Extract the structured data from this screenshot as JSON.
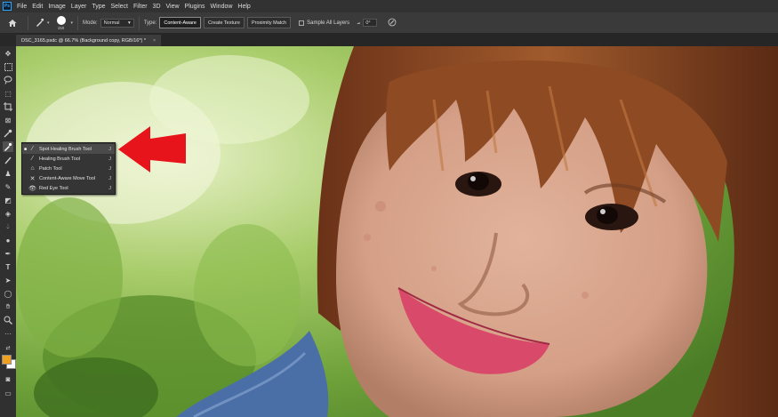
{
  "app": {
    "logo": "Ps"
  },
  "menu": [
    "File",
    "Edit",
    "Image",
    "Layer",
    "Type",
    "Select",
    "Filter",
    "3D",
    "View",
    "Plugins",
    "Window",
    "Help"
  ],
  "options": {
    "brush_size": "150",
    "mode_label": "Mode:",
    "mode_value": "Normal",
    "type_label": "Type:",
    "type_buttons": [
      "Content-Aware",
      "Create Texture",
      "Proximity Match"
    ],
    "sample_all_layers": "Sample All Layers",
    "angle_value": "0°"
  },
  "document_tab": {
    "title": "DSC_3165.psdc @ 66.7% (Background copy, RGB/16*) *",
    "close": "×"
  },
  "flyout": [
    {
      "label": "Spot Healing Brush Tool",
      "shortcut": "J",
      "icon": "spot-healing-brush-icon",
      "selected": true
    },
    {
      "label": "Healing Brush Tool",
      "shortcut": "J",
      "icon": "healing-brush-icon",
      "selected": false
    },
    {
      "label": "Patch Tool",
      "shortcut": "J",
      "icon": "patch-icon",
      "selected": false
    },
    {
      "label": "Content-Aware Move Tool",
      "shortcut": "J",
      "icon": "content-aware-move-icon",
      "selected": false
    },
    {
      "label": "Red Eye Tool",
      "shortcut": "J",
      "icon": "red-eye-icon",
      "selected": false
    }
  ],
  "colors": {
    "foreground": "#f0a020",
    "background": "#ffffff",
    "accent": "#e8141c"
  }
}
